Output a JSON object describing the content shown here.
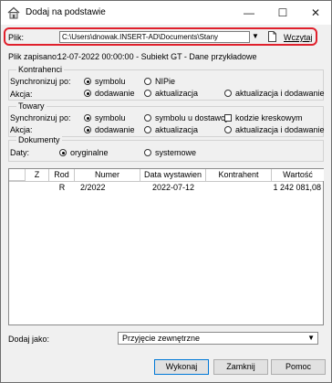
{
  "window": {
    "title": "Dodaj na podstawie",
    "minimize_glyph": "—",
    "maximize_glyph": "☐",
    "close_glyph": "✕"
  },
  "file": {
    "label": "Plik:",
    "path": "C:\\Users\\dnowak.INSERT-AD\\Documents\\Stany magazyn",
    "load_link": "Wczytaj"
  },
  "saved": {
    "label": "Plik zapisano:",
    "value": "12-07-2022 00:00:00 - Subiekt GT - Dane przykładowe"
  },
  "kontrahenci": {
    "legend": "Kontrahenci",
    "sync_label": "Synchronizuj po:",
    "sync_options": [
      "symbolu",
      "NIPie"
    ],
    "action_label": "Akcja:",
    "action_options": [
      "dodawanie",
      "aktualizacja",
      "aktualizacja i dodawanie"
    ]
  },
  "towary": {
    "legend": "Towary",
    "sync_label": "Synchronizuj po:",
    "sync_options": [
      "symbolu",
      "symbolu u dostawcy",
      "kodzie kreskowym"
    ],
    "action_label": "Akcja:",
    "action_options": [
      "dodawanie",
      "aktualizacja",
      "aktualizacja i dodawanie"
    ]
  },
  "dokumenty": {
    "legend": "Dokumenty",
    "dates_label": "Daty:",
    "dates_options": [
      "oryginalne",
      "systemowe"
    ]
  },
  "table": {
    "headers": [
      "Z",
      "Rod",
      "Numer",
      "Data wystawien",
      "Kontrahent",
      "Wartość"
    ],
    "rows": [
      {
        "z": "",
        "rod": "R",
        "numer": "2/2022",
        "data": "2022-07-12",
        "kontrahent": "",
        "wartosc": "1 242 081,08"
      }
    ]
  },
  "add_as": {
    "label": "Dodaj jako:",
    "value": "Przyjęcie zewnętrzne"
  },
  "buttons": {
    "execute": "Wykonaj",
    "close": "Zamknij",
    "help": "Pomoc"
  },
  "colors": {
    "highlight": "#e0202c",
    "window_bg": "#f0f0f0",
    "link": "#000000"
  }
}
